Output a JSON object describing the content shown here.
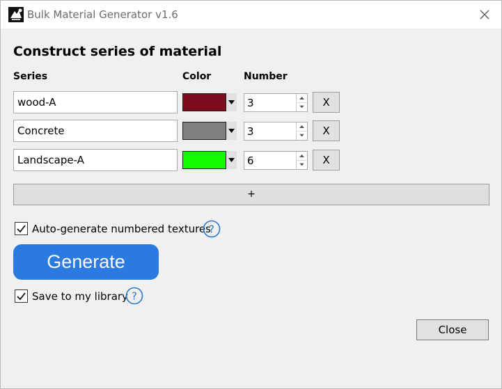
{
  "window": {
    "title": "Bulk Material Generator  v1.6"
  },
  "main": {
    "heading": "Construct series of material",
    "columns": {
      "series": "Series",
      "color": "Color",
      "number": "Number"
    },
    "rows": [
      {
        "name": "wood-A",
        "color": "#7d0c1f",
        "number": "3",
        "remove_label": "X"
      },
      {
        "name": "Concrete",
        "color": "#808080",
        "number": "3",
        "remove_label": "X"
      },
      {
        "name": "Landscape-A",
        "color": "#13ff00",
        "number": "6",
        "remove_label": "X"
      }
    ],
    "add_label": "+",
    "auto_generate": {
      "label": "Auto-generate numbered textures",
      "checked": true,
      "help_icon": "question-circle-icon"
    },
    "generate_label": "Generate",
    "save_library": {
      "label": "Save to my library",
      "checked": true,
      "help_icon": "question-circle-icon"
    },
    "close_label": "Close"
  },
  "colors": {
    "accent": "#2a7ae2",
    "help": "#2b77d0"
  }
}
